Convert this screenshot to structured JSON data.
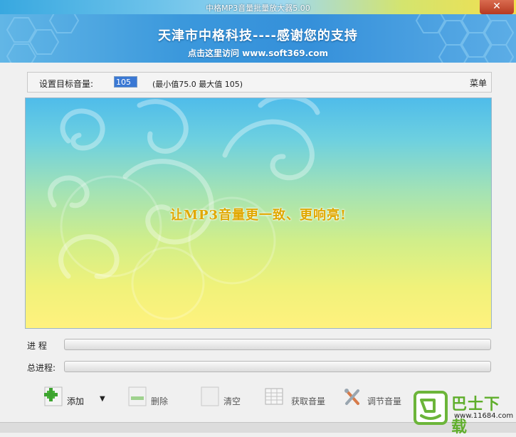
{
  "window": {
    "title": "中格MP3音量批量放大器5.00",
    "close_label": "✕"
  },
  "banner": {
    "main_text": "天津市中格科技----感谢您的支持",
    "link_text": "点击这里访问 www.soft369.com"
  },
  "settings": {
    "target_volume_label": "设置目标音量:",
    "target_volume_value": "105",
    "min_max_text": "(最小值75.0    最大值 105)",
    "menu_label": "菜单"
  },
  "panel": {
    "slogan": "让MP3音量更一致、更响亮!"
  },
  "progress": {
    "current_label": "进    程",
    "current_value": 0,
    "total_label": "总进程:",
    "total_value": 0
  },
  "toolbar": {
    "add_label": "添加",
    "delete_label": "删除",
    "clear_label": "清空",
    "get_volume_label": "获取音量",
    "adjust_volume_label": "调节音量"
  },
  "watermark": {
    "title": "巴士下载",
    "url": "www.11684.com"
  },
  "colors": {
    "accent": "#3590da",
    "slogan": "#e0a800",
    "watermark_green": "#5fae2b"
  }
}
